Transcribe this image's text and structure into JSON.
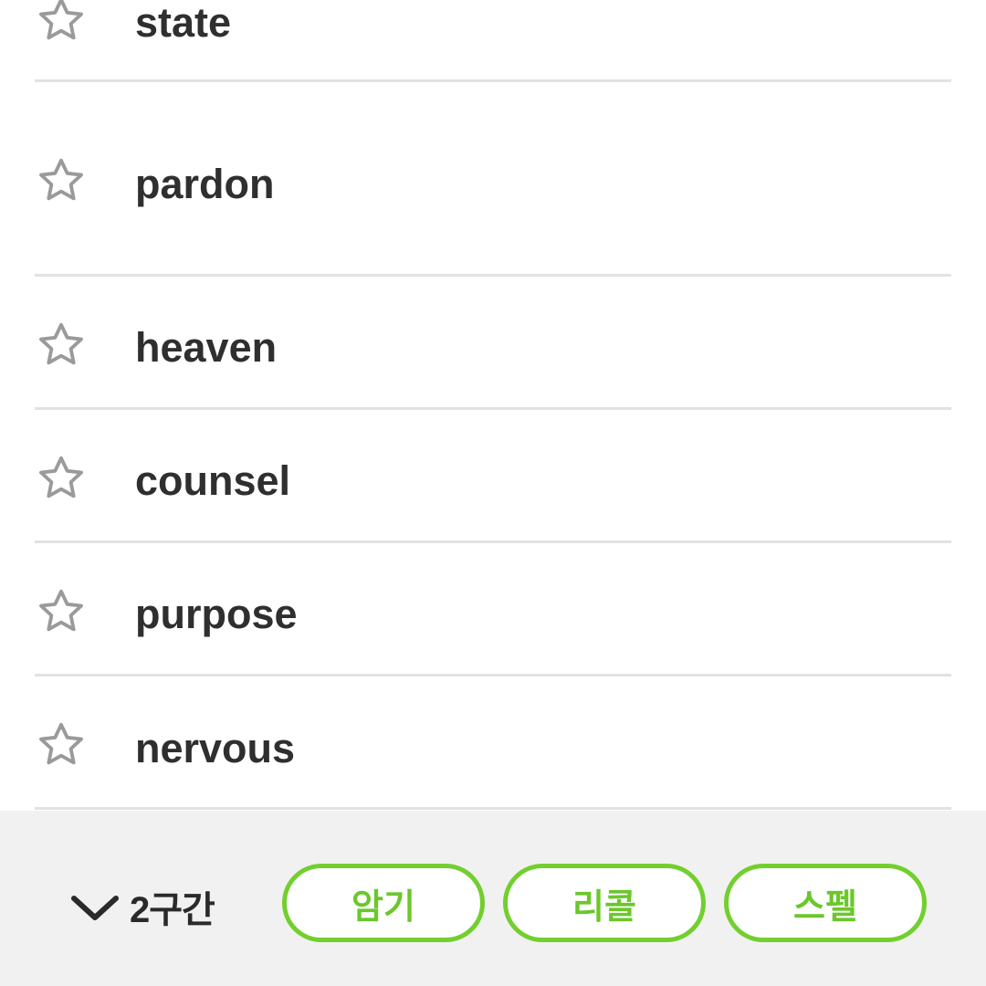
{
  "words": [
    {
      "text": "state",
      "starred": false
    },
    {
      "text": "pardon",
      "starred": false
    },
    {
      "text": "heaven",
      "starred": false
    },
    {
      "text": "counsel",
      "starred": false
    },
    {
      "text": "purpose",
      "starred": false
    },
    {
      "text": "nervous",
      "starred": false
    }
  ],
  "bottom_bar": {
    "section_label": "2구간",
    "section_icon": "chevron-down-icon",
    "buttons": [
      {
        "label": "암기"
      },
      {
        "label": "리콜"
      },
      {
        "label": "스펠"
      }
    ]
  },
  "colors": {
    "accent": "#72cf2e",
    "accent_text": "#6bc72a",
    "star_outline": "#9a9a9a",
    "word_text": "#2f2f2f",
    "divider": "#e2e2e2",
    "bar_background": "#f1f1f1"
  }
}
